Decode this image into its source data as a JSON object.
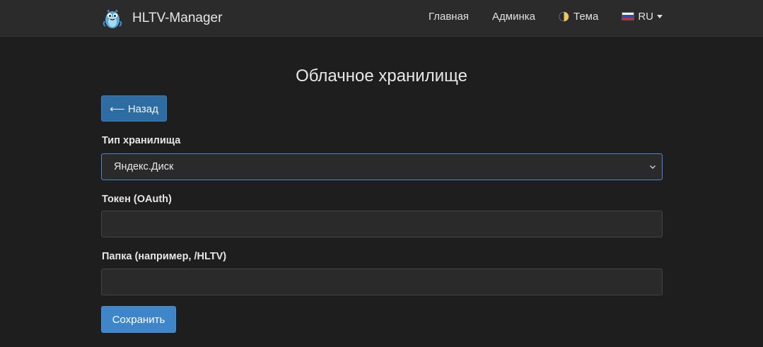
{
  "navbar": {
    "brand": "HLTV-Manager",
    "links": {
      "home": "Главная",
      "admin": "Админка",
      "theme": "Тема",
      "language": "RU"
    }
  },
  "page": {
    "title": "Облачное хранилище",
    "back_label": "⟵ Назад"
  },
  "form": {
    "storage_type": {
      "label": "Тип хранилища",
      "value": "Яндекс.Диск"
    },
    "token": {
      "label": "Токен (OAuth)",
      "value": ""
    },
    "folder": {
      "label": "Папка (например, /HLTV)",
      "value": ""
    },
    "save_label": "Сохранить"
  },
  "colors": {
    "primary": "#3e86c9",
    "back_button": "#2e6da4",
    "background": "#1e1e1e",
    "navbar": "#2b2b2b"
  }
}
